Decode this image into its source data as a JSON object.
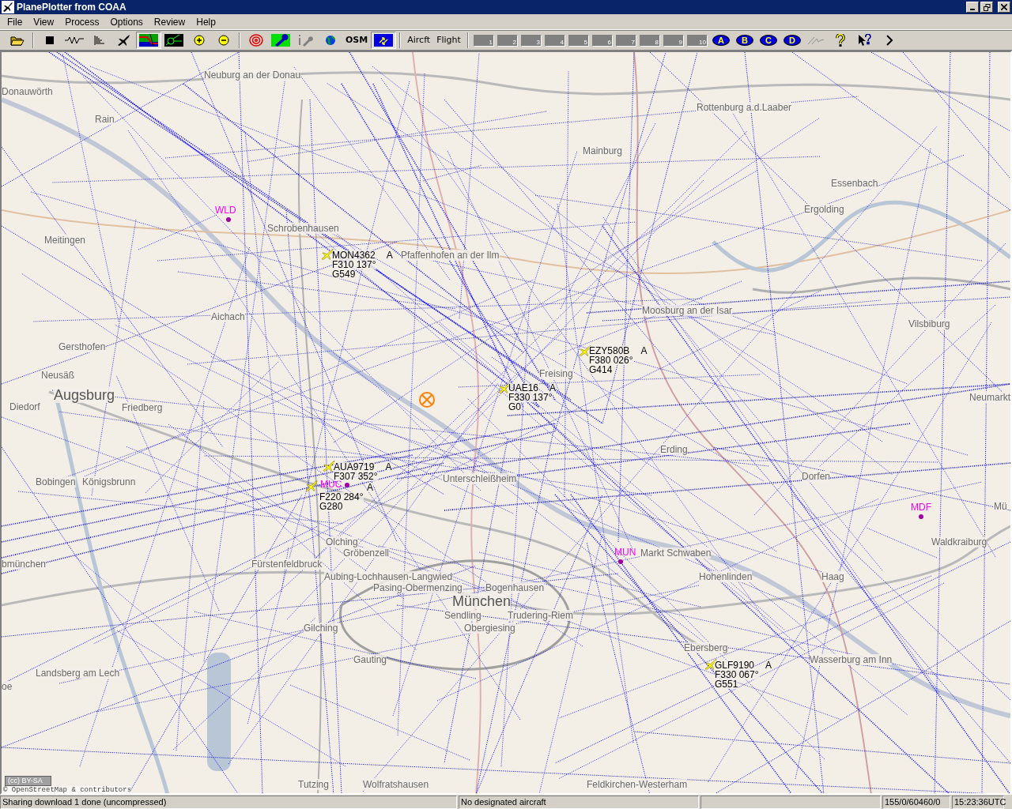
{
  "window": {
    "title": "PlanePlotter from COAA"
  },
  "menu": [
    "File",
    "View",
    "Process",
    "Options",
    "Review",
    "Help"
  ],
  "toolbar": [
    {
      "kind": "open",
      "pressed": false
    },
    {
      "kind": "sep"
    },
    {
      "kind": "stop",
      "pressed": false
    },
    {
      "kind": "wave",
      "pressed": false
    },
    {
      "kind": "list",
      "pressed": false
    },
    {
      "kind": "plane",
      "pressed": false
    },
    {
      "kind": "mapview",
      "pressed": true
    },
    {
      "kind": "vector",
      "pressed": false
    },
    {
      "kind": "zoomin",
      "pressed": false
    },
    {
      "kind": "zoomout",
      "pressed": false
    },
    {
      "kind": "sep"
    },
    {
      "kind": "target",
      "pressed": false
    },
    {
      "kind": "wrench",
      "pressed": false
    },
    {
      "kind": "tools",
      "pressed": false
    },
    {
      "kind": "globe",
      "pressed": false
    },
    {
      "kind": "text",
      "label": "OSM",
      "pressed": false
    },
    {
      "kind": "swap",
      "pressed": true
    },
    {
      "kind": "sep"
    },
    {
      "kind": "text",
      "label": "Aircft",
      "pressed": false
    },
    {
      "kind": "text",
      "label": "Flight",
      "pressed": false
    },
    {
      "kind": "sep"
    },
    {
      "kind": "slot",
      "label": "1",
      "pressed": false
    },
    {
      "kind": "slot",
      "label": "2",
      "pressed": false
    },
    {
      "kind": "slot",
      "label": "3",
      "pressed": false
    },
    {
      "kind": "slot",
      "label": "4",
      "pressed": false
    },
    {
      "kind": "slot",
      "label": "5",
      "pressed": false
    },
    {
      "kind": "slot",
      "label": "6",
      "pressed": false
    },
    {
      "kind": "slot",
      "label": "7",
      "pressed": false
    },
    {
      "kind": "slot",
      "label": "8",
      "pressed": false
    },
    {
      "kind": "slot",
      "label": "9",
      "pressed": false
    },
    {
      "kind": "slot",
      "label": "10",
      "pressed": false
    },
    {
      "kind": "letter",
      "label": "A",
      "pressed": false
    },
    {
      "kind": "letter",
      "label": "B",
      "pressed": false
    },
    {
      "kind": "letter",
      "label": "C",
      "pressed": false
    },
    {
      "kind": "letter",
      "label": "D",
      "pressed": false
    },
    {
      "kind": "pen",
      "pressed": false
    },
    {
      "kind": "help",
      "pressed": false
    },
    {
      "kind": "pointerhelp",
      "pressed": false
    },
    {
      "kind": "more",
      "pressed": false
    }
  ],
  "map": {
    "places": [
      {
        "name": "Neuburg an der Donau"
      },
      {
        "name": "Donauwörth"
      },
      {
        "name": "Rottenburg a.d.Laaber"
      },
      {
        "name": "Rain"
      },
      {
        "name": "Mainburg"
      },
      {
        "name": "Essenbach"
      },
      {
        "name": "Ergolding"
      },
      {
        "name": "Schrobenhausen"
      },
      {
        "name": "Meitingen"
      },
      {
        "name": "Pfaffenhofen an der Ilm"
      },
      {
        "name": "Aichach"
      },
      {
        "name": "Moosburg an der Isar"
      },
      {
        "name": "Vilsbiburg"
      },
      {
        "name": "Gersthofen"
      },
      {
        "name": "Neusäß"
      },
      {
        "name": "Freising"
      },
      {
        "name": "Diedorf"
      },
      {
        "name": "Augsburg",
        "major": true
      },
      {
        "name": "Friedberg"
      },
      {
        "name": "Neumarkt"
      },
      {
        "name": "Erding"
      },
      {
        "name": "Bobingen"
      },
      {
        "name": "Königsbrunn"
      },
      {
        "name": "Unterschleißheim"
      },
      {
        "name": "Dorfen"
      },
      {
        "name": "Mü"
      },
      {
        "name": "Olching"
      },
      {
        "name": "Waldkraiburg"
      },
      {
        "name": "Gröbenzell"
      },
      {
        "name": "Markt Schwaben"
      },
      {
        "name": "bmünchen"
      },
      {
        "name": "Fürstenfeldbruck"
      },
      {
        "name": "Aubing-Lochhausen-Langwied"
      },
      {
        "name": "Hohenlinden"
      },
      {
        "name": "Haag"
      },
      {
        "name": "Pasing-Obermenzing"
      },
      {
        "name": "Bogenhausen"
      },
      {
        "name": "München",
        "major": true
      },
      {
        "name": "Sendling"
      },
      {
        "name": "Trudering-Riem"
      },
      {
        "name": "Gilching"
      },
      {
        "name": "Obergiesing"
      },
      {
        "name": "Ebersberg"
      },
      {
        "name": "Gauting"
      },
      {
        "name": "Wasserburg am Inn"
      },
      {
        "name": "Landsberg am Lech"
      },
      {
        "name": "oe"
      },
      {
        "name": "Tutzing"
      },
      {
        "name": "Wolfratshausen"
      },
      {
        "name": "Feldkirchen-Westerham"
      }
    ],
    "waypoints": [
      {
        "name": "WLD"
      },
      {
        "name": "MUC"
      },
      {
        "name": "MUN"
      },
      {
        "name": "MDF"
      }
    ],
    "aircraft": [
      {
        "callsign": "MON4362",
        "status": "A",
        "altitude": "F310 137°",
        "speed": "G549"
      },
      {
        "callsign": "EZY580B",
        "status": "A",
        "altitude": "F380 026°",
        "speed": "G414"
      },
      {
        "callsign": "UAE16",
        "status": "A",
        "altitude": "F330 137°",
        "speed": "G0"
      },
      {
        "callsign": "AUA9719",
        "status": "A",
        "altitude": "F307 352°"
      },
      {
        "status": "A",
        "altitude": "F220 284°",
        "speed": "G280"
      },
      {
        "callsign": "GLF9190",
        "status": "A",
        "altitude": "F330 067°",
        "speed": "G551"
      }
    ],
    "license": "(cc) BY-SA",
    "attribution": "© OpenStreetMap & contributors"
  },
  "status_bar": [
    "Sharing download 1 done (uncompressed)",
    "No designated aircraft",
    "155/0/60460/0",
    "15:23:36UTC"
  ]
}
